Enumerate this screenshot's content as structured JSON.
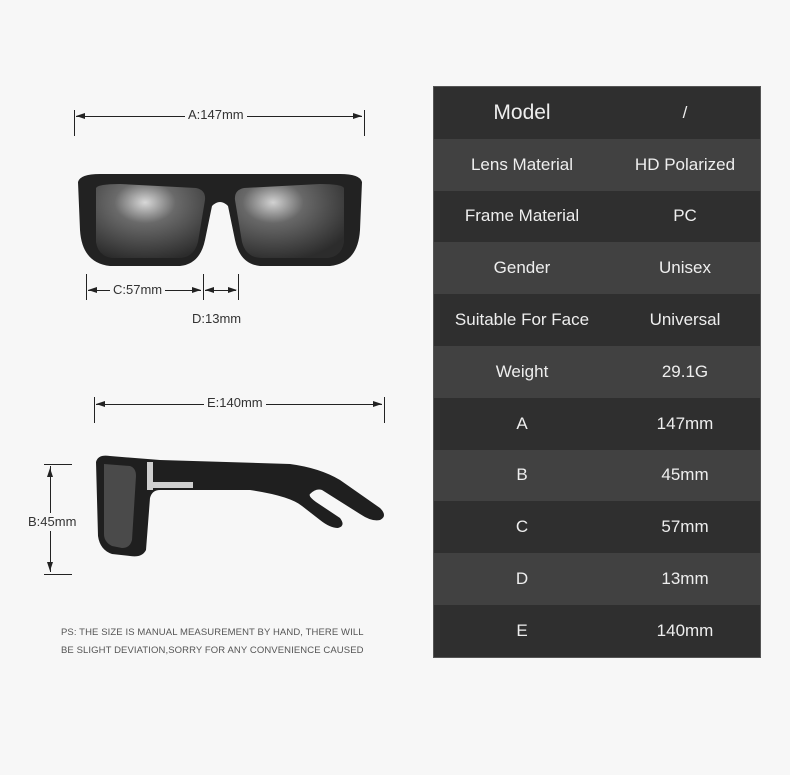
{
  "dimensions": {
    "a": "A:147mm",
    "c": "C:57mm",
    "d": "D:13mm",
    "e": "E:140mm",
    "b": "B:45mm"
  },
  "note": {
    "line1": "PS: THE SIZE IS MANUAL MEASUREMENT BY HAND, THERE WILL",
    "line2": "BE SLIGHT DEVIATION,SORRY FOR ANY CONVENIENCE CAUSED"
  },
  "spec_table": {
    "rows": [
      {
        "label": "Model",
        "value": "/"
      },
      {
        "label": "Lens Material",
        "value": "HD Polarized"
      },
      {
        "label": "Frame Material",
        "value": "PC"
      },
      {
        "label": "Gender",
        "value": "Unisex"
      },
      {
        "label": "Suitable For Face",
        "value": "Universal"
      },
      {
        "label": "Weight",
        "value": "29.1G"
      },
      {
        "label": "A",
        "value": "147mm"
      },
      {
        "label": "B",
        "value": "45mm"
      },
      {
        "label": "C",
        "value": "57mm"
      },
      {
        "label": "D",
        "value": "13mm"
      },
      {
        "label": "E",
        "value": "140mm"
      }
    ]
  },
  "colors": {
    "table_dark": "#2f2f2f",
    "table_light": "#414141",
    "background": "#f7f7f7"
  }
}
